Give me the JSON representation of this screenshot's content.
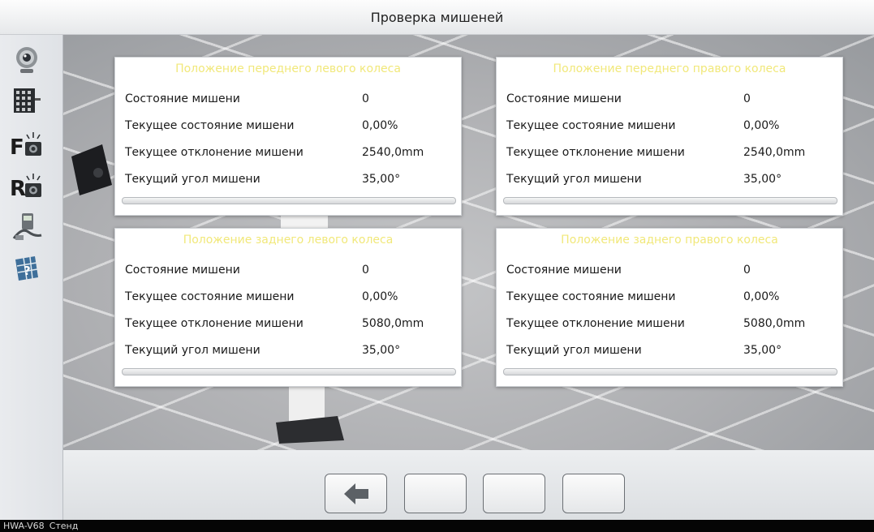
{
  "window": {
    "title": "Проверка мишеней"
  },
  "sidebar": {
    "items": [
      {
        "icon": "webcam-icon"
      },
      {
        "icon": "target-board-icon"
      },
      {
        "icon": "front-camera-icon",
        "label": "F"
      },
      {
        "icon": "rear-camera-icon",
        "label": "R"
      },
      {
        "icon": "inclinometer-icon"
      },
      {
        "icon": "calibration-icon"
      }
    ]
  },
  "panels": [
    {
      "title": "Положение переднего левого колеса",
      "rows": [
        {
          "label": "Состояние мишени",
          "value": "0"
        },
        {
          "label": "Текущее состояние мишени",
          "value": "0,00%"
        },
        {
          "label": "Текущее отклонение мишени",
          "value": "2540,0mm"
        },
        {
          "label": "Текущий угол мишени",
          "value": "35,00°"
        }
      ],
      "progress": 0
    },
    {
      "title": "Положение переднего правого колеса",
      "rows": [
        {
          "label": "Состояние мишени",
          "value": "0"
        },
        {
          "label": "Текущее состояние мишени",
          "value": "0,00%"
        },
        {
          "label": "Текущее отклонение мишени",
          "value": "2540,0mm"
        },
        {
          "label": "Текущий угол мишени",
          "value": "35,00°"
        }
      ],
      "progress": 0
    },
    {
      "title": "Положение заднего левого колеса",
      "rows": [
        {
          "label": "Состояние мишени",
          "value": "0"
        },
        {
          "label": "Текущее состояние мишени",
          "value": "0,00%"
        },
        {
          "label": "Текущее отклонение мишени",
          "value": "5080,0mm"
        },
        {
          "label": "Текущий угол мишени",
          "value": "35,00°"
        }
      ],
      "progress": 0
    },
    {
      "title": "Положение заднего правого колеса",
      "rows": [
        {
          "label": "Состояние мишени",
          "value": "0"
        },
        {
          "label": "Текущее состояние мишени",
          "value": "0,00%"
        },
        {
          "label": "Текущее отклонение мишени",
          "value": "5080,0mm"
        },
        {
          "label": "Текущий угол мишени",
          "value": "35,00°"
        }
      ],
      "progress": 0
    }
  ],
  "toolbar": {
    "buttons": [
      {
        "icon": "back-arrow-icon"
      },
      {
        "icon": ""
      },
      {
        "icon": ""
      },
      {
        "icon": ""
      }
    ]
  },
  "statusbar": {
    "model": "HWA-V68",
    "mode": "Стенд"
  },
  "colors": {
    "panel_title": "#f1e87a",
    "progress_fill": "#57a74b",
    "statusbar_bg": "#050505"
  }
}
